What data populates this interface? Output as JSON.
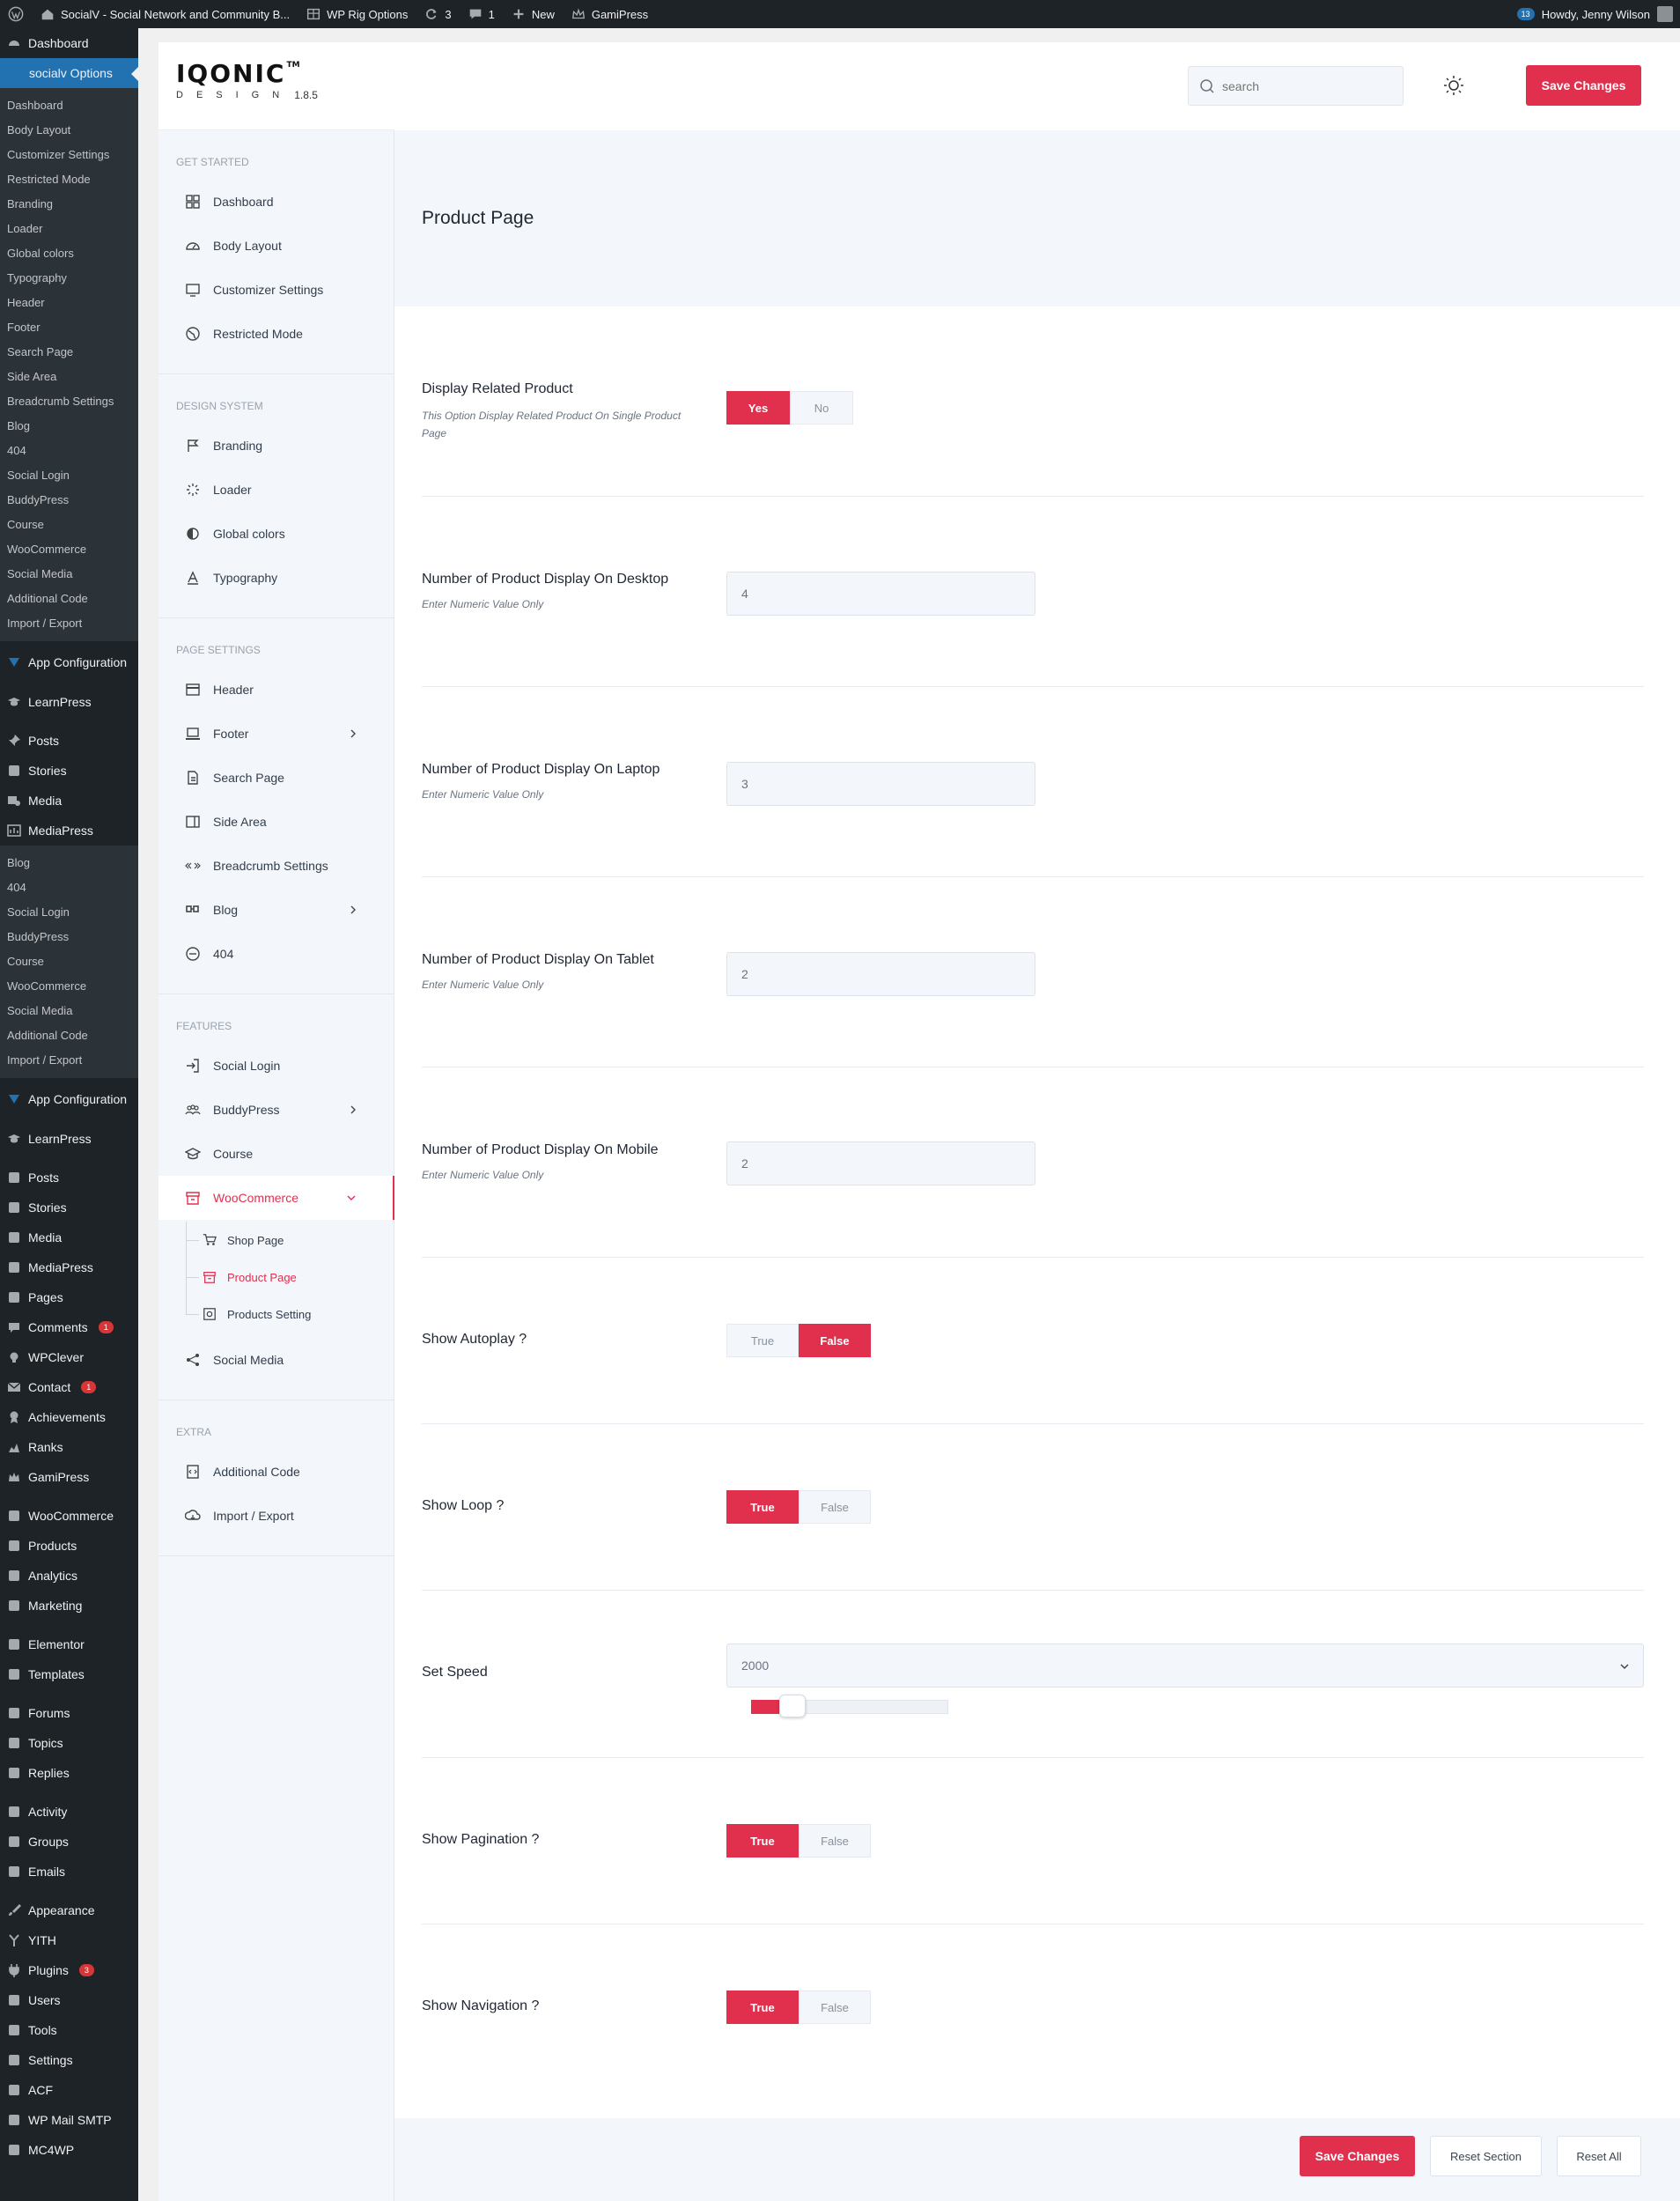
{
  "adminbar": {
    "site_name": "SocialV - Social Network and Community B...",
    "rig_options": "WP Rig Options",
    "updates_count": "3",
    "comments_count": "1",
    "new_label": "New",
    "gamipress_label": "GamiPress",
    "notif_count": "13",
    "howdy": "Howdy, Jenny Wilson"
  },
  "adminmenu": {
    "dashboard": "Dashboard",
    "current": "socialv Options",
    "sub1": [
      "Dashboard",
      "Body Layout",
      "Customizer Settings",
      "Restricted Mode",
      "Branding",
      "Loader",
      "Global colors",
      "Typography",
      "Header",
      "Footer",
      "Search Page",
      "Side Area",
      "Breadcrumb Settings",
      "Blog",
      "404",
      "Social Login",
      "BuddyPress",
      "Course",
      "WooCommerce",
      "Social Media",
      "Additional Code",
      "Import / Export"
    ],
    "app_config": "App Configuration",
    "learnpress": "LearnPress",
    "posts": "Posts",
    "stories": "Stories",
    "media": "Media",
    "mediapress": "MediaPress",
    "sub2": [
      "Blog",
      "404",
      "Social Login",
      "BuddyPress",
      "Course",
      "WooCommerce",
      "Social Media",
      "Additional Code",
      "Import / Export"
    ],
    "app_config2": "App Configuration",
    "learnpress2": "LearnPress",
    "group_a": [
      "Posts",
      "Stories",
      "Media",
      "MediaPress",
      "Pages"
    ],
    "comments": "Comments",
    "comments_count": "1",
    "wpclever": "WPClever",
    "contact": "Contact",
    "contact_count": "1",
    "achievements": "Achievements",
    "ranks": "Ranks",
    "gamipress": "GamiPress",
    "group_b": [
      "WooCommerce",
      "Products",
      "Analytics",
      "Marketing"
    ],
    "group_c": [
      "Elementor",
      "Templates"
    ],
    "group_d": [
      "Forums",
      "Topics",
      "Replies"
    ],
    "group_e": [
      "Activity",
      "Groups",
      "Emails"
    ],
    "appearance": "Appearance",
    "yith": "YITH",
    "plugins": "Plugins",
    "plugins_count": "3",
    "group_f": [
      "Users",
      "Tools",
      "Settings",
      "ACF",
      "WP Mail SMTP",
      "MC4WP"
    ]
  },
  "brand": {
    "name": "IQONIC",
    "tm": "TM",
    "sub": "DESIGN",
    "version": "1.8.5"
  },
  "nav": {
    "get_started": {
      "title": "GET STARTED",
      "items": [
        "Dashboard",
        "Body Layout",
        "Customizer Settings",
        "Restricted Mode"
      ]
    },
    "design_system": {
      "title": "DESIGN SYSTEM",
      "items": [
        "Branding",
        "Loader",
        "Global colors",
        "Typography"
      ]
    },
    "page_settings": {
      "title": "PAGE SETTINGS",
      "items": [
        "Header",
        "Footer",
        "Search Page",
        "Side Area",
        "Breadcrumb Settings",
        "Blog",
        "404"
      ]
    },
    "features": {
      "title": "FEATURES",
      "items": [
        "Social Login",
        "BuddyPress",
        "Course",
        "WooCommerce",
        "Social Media"
      ],
      "woo_sub": [
        "Shop Page",
        "Product Page",
        "Products Setting"
      ]
    },
    "extra": {
      "title": "EXTRA",
      "items": [
        "Additional Code",
        "Import / Export"
      ]
    }
  },
  "topbar": {
    "search_placeholder": "search",
    "save_label": "Save Changes"
  },
  "page": {
    "title": "Product Page"
  },
  "fields": {
    "related": {
      "label": "Display Related Product",
      "desc": "This Option Display Related Product On Single Product Page",
      "options": [
        "Yes",
        "No"
      ],
      "selected": "Yes"
    },
    "desktop": {
      "label": "Number of Product Display On Desktop",
      "desc": "Enter Numeric Value Only",
      "value": "4"
    },
    "laptop": {
      "label": "Number of Product Display On Laptop",
      "desc": "Enter Numeric Value Only",
      "value": "3"
    },
    "tablet": {
      "label": "Number of Product Display On Tablet",
      "desc": "Enter Numeric Value Only",
      "value": "2"
    },
    "mobile": {
      "label": "Number of Product Display On Mobile",
      "desc": "Enter Numeric Value Only",
      "value": "2"
    },
    "autoplay": {
      "label": "Show Autoplay ?",
      "options": [
        "True",
        "False"
      ],
      "selected": "False"
    },
    "loop": {
      "label": "Show Loop ?",
      "options": [
        "True",
        "False"
      ],
      "selected": "True"
    },
    "speed": {
      "label": "Set Speed",
      "value": "2000",
      "slider_fraction": 0.1
    },
    "pagination": {
      "label": "Show Pagination ?",
      "options": [
        "True",
        "False"
      ],
      "selected": "True"
    },
    "navigation": {
      "label": "Show Navigation ?",
      "options": [
        "True",
        "False"
      ],
      "selected": "True"
    }
  },
  "footer": {
    "save_label": "Save Changes",
    "reset_section": "Reset Section",
    "reset_all": "Reset All"
  },
  "colors": {
    "accent": "#e0304e",
    "wp_blue": "#2271b1",
    "admin_dark": "#1d2327"
  }
}
